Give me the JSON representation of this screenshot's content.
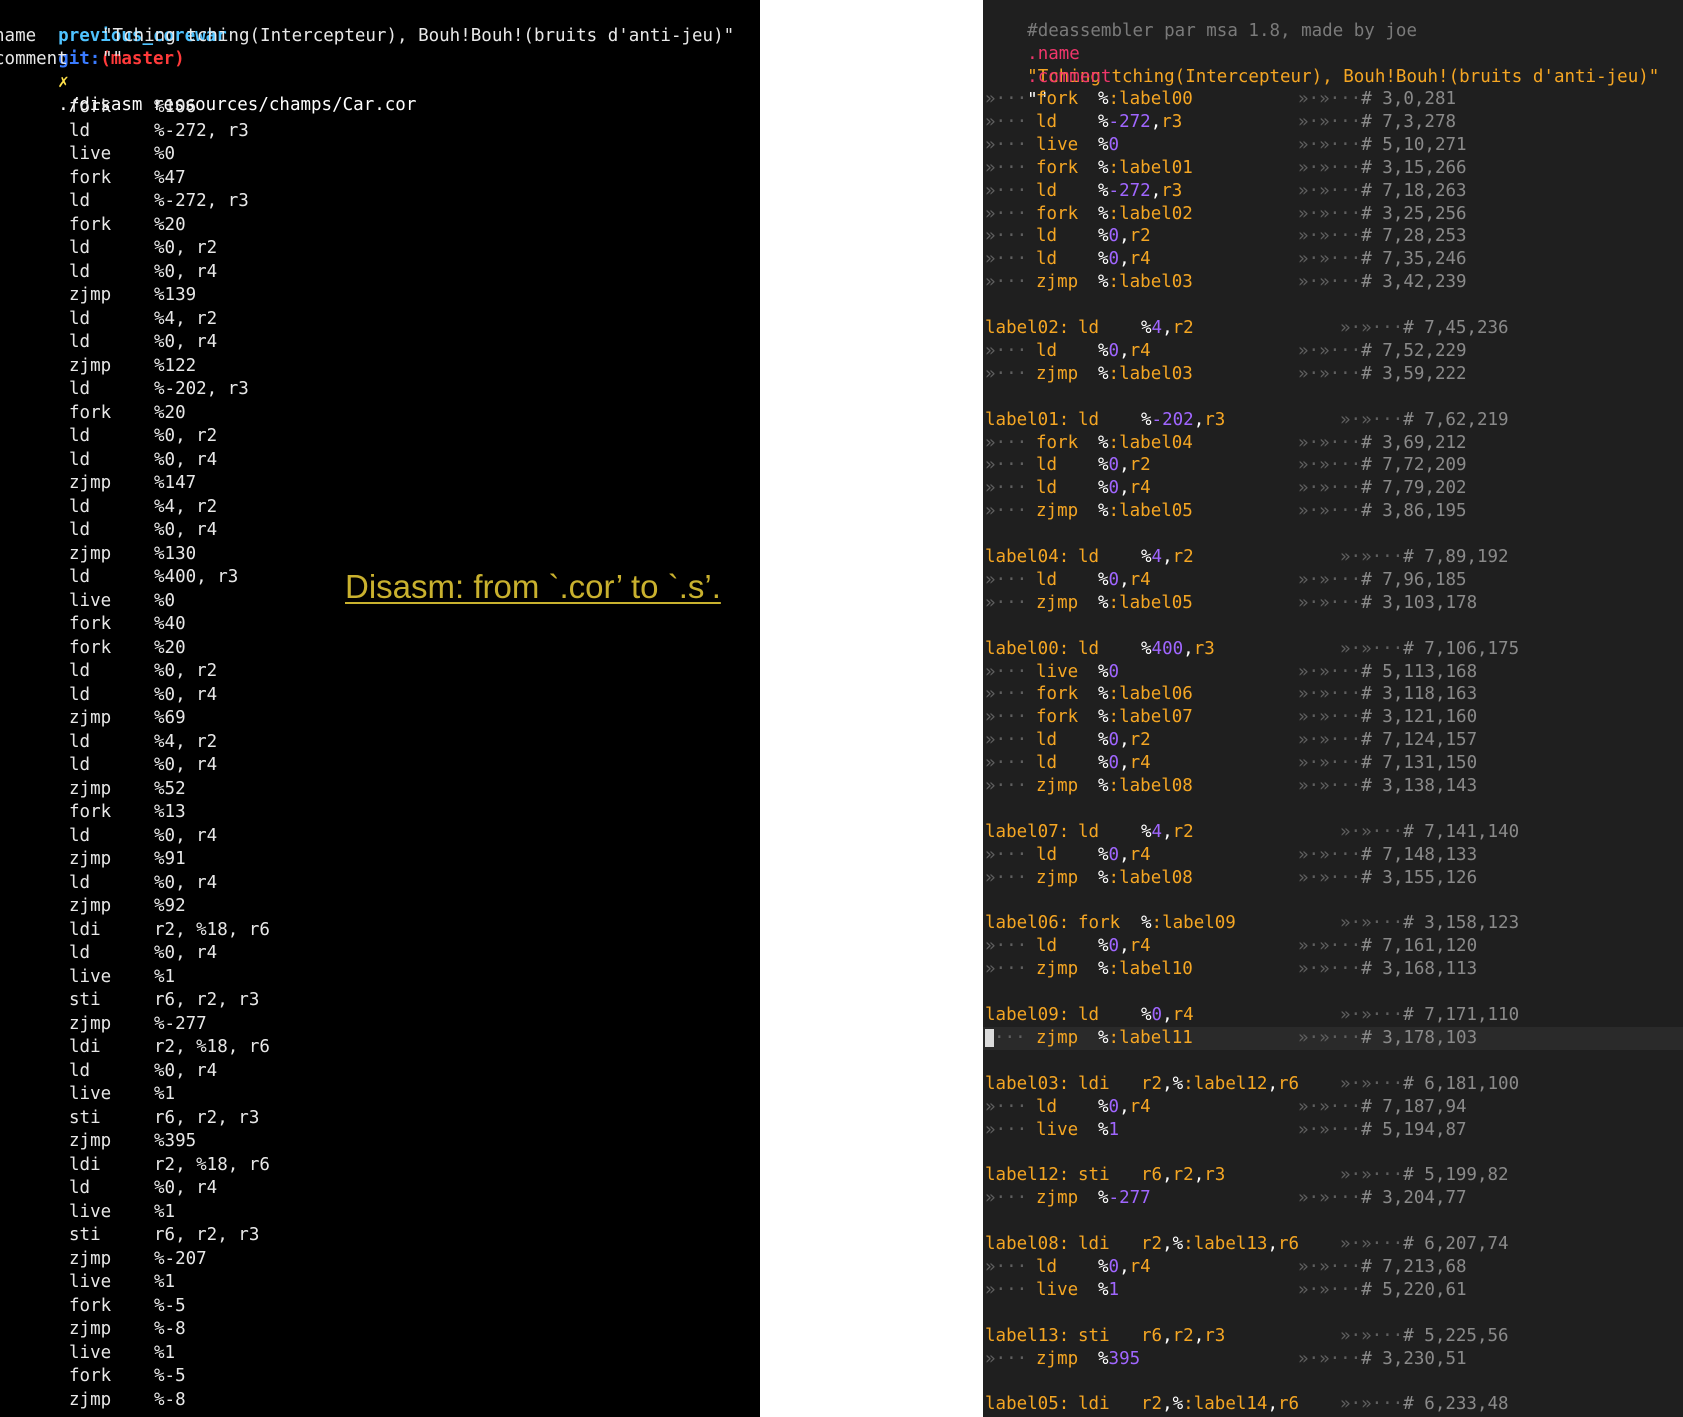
{
  "terminal": {
    "prompt": {
      "dir": "previous_corewar",
      "git": "git:",
      "branch": "(master)",
      "x": "✗",
      "command": "./disasm ressources/champs/Car.cor"
    },
    "header": [
      {
        "key": "name",
        "value": "\"Tching tching(Intercepteur), Bouh!Bouh!(bruits d'anti-jeu)\""
      },
      {
        "key": "comment",
        "value": "\"\""
      }
    ],
    "instructions": [
      {
        "op": "fork",
        "args": "%106"
      },
      {
        "op": "ld",
        "args": "%-272, r3"
      },
      {
        "op": "live",
        "args": "%0"
      },
      {
        "op": "fork",
        "args": "%47"
      },
      {
        "op": "ld",
        "args": "%-272, r3"
      },
      {
        "op": "fork",
        "args": "%20"
      },
      {
        "op": "ld",
        "args": "%0, r2"
      },
      {
        "op": "ld",
        "args": "%0, r4"
      },
      {
        "op": "zjmp",
        "args": "%139"
      },
      {
        "op": "ld",
        "args": "%4, r2"
      },
      {
        "op": "ld",
        "args": "%0, r4"
      },
      {
        "op": "zjmp",
        "args": "%122"
      },
      {
        "op": "ld",
        "args": "%-202, r3"
      },
      {
        "op": "fork",
        "args": "%20"
      },
      {
        "op": "ld",
        "args": "%0, r2"
      },
      {
        "op": "ld",
        "args": "%0, r4"
      },
      {
        "op": "zjmp",
        "args": "%147"
      },
      {
        "op": "ld",
        "args": "%4, r2"
      },
      {
        "op": "ld",
        "args": "%0, r4"
      },
      {
        "op": "zjmp",
        "args": "%130"
      },
      {
        "op": "ld",
        "args": "%400, r3"
      },
      {
        "op": "live",
        "args": "%0"
      },
      {
        "op": "fork",
        "args": "%40"
      },
      {
        "op": "fork",
        "args": "%20"
      },
      {
        "op": "ld",
        "args": "%0, r2"
      },
      {
        "op": "ld",
        "args": "%0, r4"
      },
      {
        "op": "zjmp",
        "args": "%69"
      },
      {
        "op": "ld",
        "args": "%4, r2"
      },
      {
        "op": "ld",
        "args": "%0, r4"
      },
      {
        "op": "zjmp",
        "args": "%52"
      },
      {
        "op": "fork",
        "args": "%13"
      },
      {
        "op": "ld",
        "args": "%0, r4"
      },
      {
        "op": "zjmp",
        "args": "%91"
      },
      {
        "op": "ld",
        "args": "%0, r4"
      },
      {
        "op": "zjmp",
        "args": "%92"
      },
      {
        "op": "ldi",
        "args": "r2, %18, r6"
      },
      {
        "op": "ld",
        "args": "%0, r4"
      },
      {
        "op": "live",
        "args": "%1"
      },
      {
        "op": "sti",
        "args": "r6, r2, r3"
      },
      {
        "op": "zjmp",
        "args": "%-277"
      },
      {
        "op": "ldi",
        "args": "r2, %18, r6"
      },
      {
        "op": "ld",
        "args": "%0, r4"
      },
      {
        "op": "live",
        "args": "%1"
      },
      {
        "op": "sti",
        "args": "r6, r2, r3"
      },
      {
        "op": "zjmp",
        "args": "%395"
      },
      {
        "op": "ldi",
        "args": "r2, %18, r6"
      },
      {
        "op": "ld",
        "args": "%0, r4"
      },
      {
        "op": "live",
        "args": "%1"
      },
      {
        "op": "sti",
        "args": "r6, r2, r3"
      },
      {
        "op": "zjmp",
        "args": "%-207"
      },
      {
        "op": "live",
        "args": "%1"
      },
      {
        "op": "fork",
        "args": "%-5"
      },
      {
        "op": "zjmp",
        "args": "%-8"
      },
      {
        "op": "live",
        "args": "%1"
      },
      {
        "op": "fork",
        "args": "%-5"
      },
      {
        "op": "zjmp",
        "args": "%-8"
      }
    ]
  },
  "caption": "Disasm: from `.cor’ to `.s’.",
  "editor": {
    "banner": "#deassembler par msa 1.8, made by joe",
    "name_directive": ".name",
    "name_value": "\"Tching tching(Intercepteur), Bouh!Bouh!(bruits d'anti-jeu)\"",
    "comment_directive": ".comment",
    "comment_value": "\"\"",
    "lines": [
      {
        "label": "",
        "op": "fork",
        "args": "%:label00",
        "comment": "# 3,0,281"
      },
      {
        "label": "",
        "op": "ld",
        "args": "%-272,r3",
        "comment": "# 7,3,278"
      },
      {
        "label": "",
        "op": "live",
        "args": "%0",
        "comment": "# 5,10,271"
      },
      {
        "label": "",
        "op": "fork",
        "args": "%:label01",
        "comment": "# 3,15,266"
      },
      {
        "label": "",
        "op": "ld",
        "args": "%-272,r3",
        "comment": "# 7,18,263"
      },
      {
        "label": "",
        "op": "fork",
        "args": "%:label02",
        "comment": "# 3,25,256"
      },
      {
        "label": "",
        "op": "ld",
        "args": "%0,r2",
        "comment": "# 7,28,253"
      },
      {
        "label": "",
        "op": "ld",
        "args": "%0,r4",
        "comment": "# 7,35,246"
      },
      {
        "label": "",
        "op": "zjmp",
        "args": "%:label03",
        "comment": "# 3,42,239"
      },
      {
        "blank": true
      },
      {
        "label": "label02:",
        "op": "ld",
        "args": "%4,r2",
        "comment": "# 7,45,236"
      },
      {
        "label": "",
        "op": "ld",
        "args": "%0,r4",
        "comment": "# 7,52,229"
      },
      {
        "label": "",
        "op": "zjmp",
        "args": "%:label03",
        "comment": "# 3,59,222"
      },
      {
        "blank": true
      },
      {
        "label": "label01:",
        "op": "ld",
        "args": "%-202,r3",
        "comment": "# 7,62,219"
      },
      {
        "label": "",
        "op": "fork",
        "args": "%:label04",
        "comment": "# 3,69,212"
      },
      {
        "label": "",
        "op": "ld",
        "args": "%0,r2",
        "comment": "# 7,72,209"
      },
      {
        "label": "",
        "op": "ld",
        "args": "%0,r4",
        "comment": "# 7,79,202"
      },
      {
        "label": "",
        "op": "zjmp",
        "args": "%:label05",
        "comment": "# 3,86,195"
      },
      {
        "blank": true
      },
      {
        "label": "label04:",
        "op": "ld",
        "args": "%4,r2",
        "comment": "# 7,89,192"
      },
      {
        "label": "",
        "op": "ld",
        "args": "%0,r4",
        "comment": "# 7,96,185"
      },
      {
        "label": "",
        "op": "zjmp",
        "args": "%:label05",
        "comment": "# 3,103,178"
      },
      {
        "blank": true
      },
      {
        "label": "label00:",
        "op": "ld",
        "args": "%400,r3",
        "comment": "# 7,106,175"
      },
      {
        "label": "",
        "op": "live",
        "args": "%0",
        "comment": "# 5,113,168"
      },
      {
        "label": "",
        "op": "fork",
        "args": "%:label06",
        "comment": "# 3,118,163"
      },
      {
        "label": "",
        "op": "fork",
        "args": "%:label07",
        "comment": "# 3,121,160"
      },
      {
        "label": "",
        "op": "ld",
        "args": "%0,r2",
        "comment": "# 7,124,157"
      },
      {
        "label": "",
        "op": "ld",
        "args": "%0,r4",
        "comment": "# 7,131,150"
      },
      {
        "label": "",
        "op": "zjmp",
        "args": "%:label08",
        "comment": "# 3,138,143"
      },
      {
        "blank": true
      },
      {
        "label": "label07:",
        "op": "ld",
        "args": "%4,r2",
        "comment": "# 7,141,140"
      },
      {
        "label": "",
        "op": "ld",
        "args": "%0,r4",
        "comment": "# 7,148,133"
      },
      {
        "label": "",
        "op": "zjmp",
        "args": "%:label08",
        "comment": "# 3,155,126"
      },
      {
        "blank": true
      },
      {
        "label": "label06:",
        "op": "fork",
        "args": "%:label09",
        "comment": "# 3,158,123"
      },
      {
        "label": "",
        "op": "ld",
        "args": "%0,r4",
        "comment": "# 7,161,120"
      },
      {
        "label": "",
        "op": "zjmp",
        "args": "%:label10",
        "comment": "# 3,168,113"
      },
      {
        "blank": true
      },
      {
        "label": "label09:",
        "op": "ld",
        "args": "%0,r4",
        "comment": "# 7,171,110"
      },
      {
        "label": "",
        "op": "zjmp",
        "args": "%:label11",
        "comment": "# 3,178,103",
        "cursor": true
      },
      {
        "blank": true
      },
      {
        "label": "label03:",
        "op": "ldi",
        "args": "r2,%:label12,r6",
        "comment": "# 6,181,100"
      },
      {
        "label": "",
        "op": "ld",
        "args": "%0,r4",
        "comment": "# 7,187,94"
      },
      {
        "label": "",
        "op": "live",
        "args": "%1",
        "comment": "# 5,194,87"
      },
      {
        "blank": true
      },
      {
        "label": "label12:",
        "op": "sti",
        "args": "r6,r2,r3",
        "comment": "# 5,199,82"
      },
      {
        "label": "",
        "op": "zjmp",
        "args": "%-277",
        "comment": "# 3,204,77"
      },
      {
        "blank": true
      },
      {
        "label": "label08:",
        "op": "ldi",
        "args": "r2,%:label13,r6",
        "comment": "# 6,207,74"
      },
      {
        "label": "",
        "op": "ld",
        "args": "%0,r4",
        "comment": "# 7,213,68"
      },
      {
        "label": "",
        "op": "live",
        "args": "%1",
        "comment": "# 5,220,61"
      },
      {
        "blank": true
      },
      {
        "label": "label13:",
        "op": "sti",
        "args": "r6,r2,r3",
        "comment": "# 5,225,56"
      },
      {
        "label": "",
        "op": "zjmp",
        "args": "%395",
        "comment": "# 3,230,51"
      },
      {
        "blank": true
      },
      {
        "label": "label05:",
        "op": "ldi",
        "args": "r2,%:label14,r6",
        "comment": "# 6,233,48"
      }
    ]
  }
}
